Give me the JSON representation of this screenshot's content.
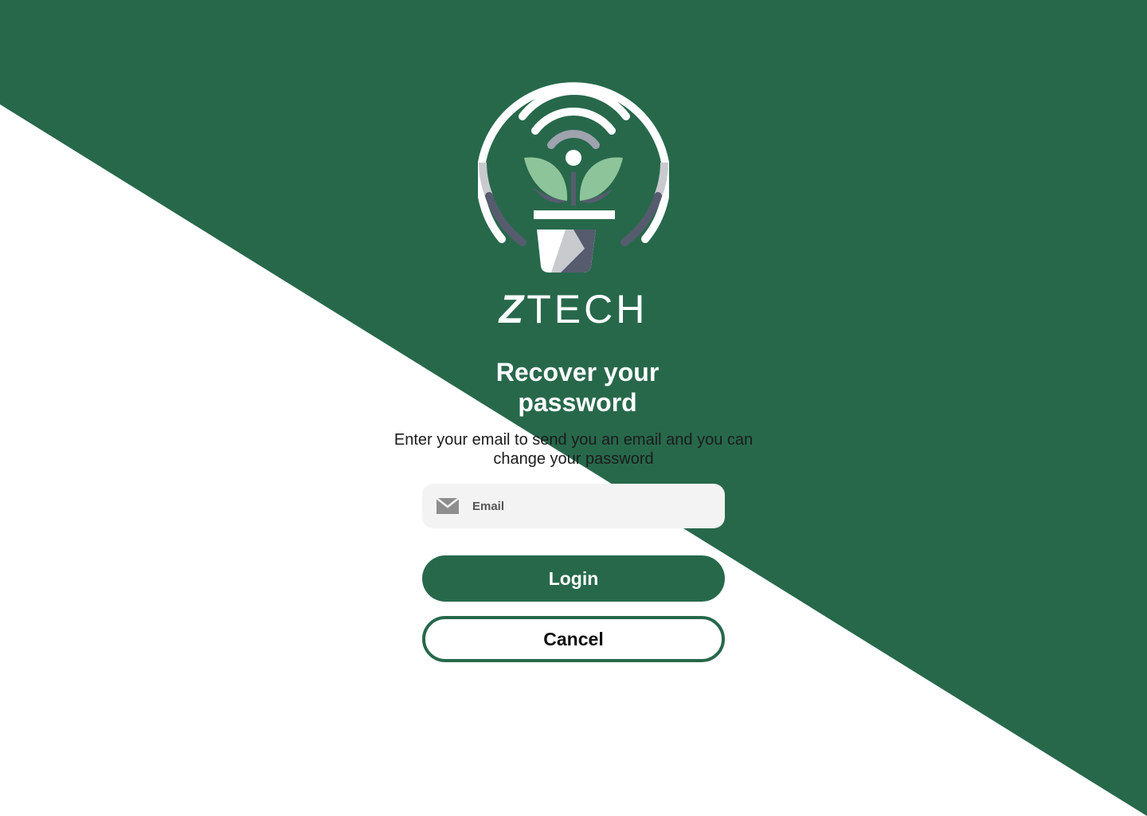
{
  "brand": {
    "name_prefix": "Z",
    "name_suffix": "TECH"
  },
  "page": {
    "title": "Recover your password",
    "subtitle": "Enter your email to send you an email and you can change your password"
  },
  "form": {
    "email": {
      "placeholder": "Email",
      "value": "",
      "icon": "mail-icon"
    },
    "login_label": "Login",
    "cancel_label": "Cancel"
  },
  "colors": {
    "brand_green": "#27684b",
    "leaf_green": "#8dc49a",
    "slate": "#565c6e",
    "silver": "#c8cace",
    "field_bg": "#f3f3f3",
    "white": "#ffffff"
  }
}
